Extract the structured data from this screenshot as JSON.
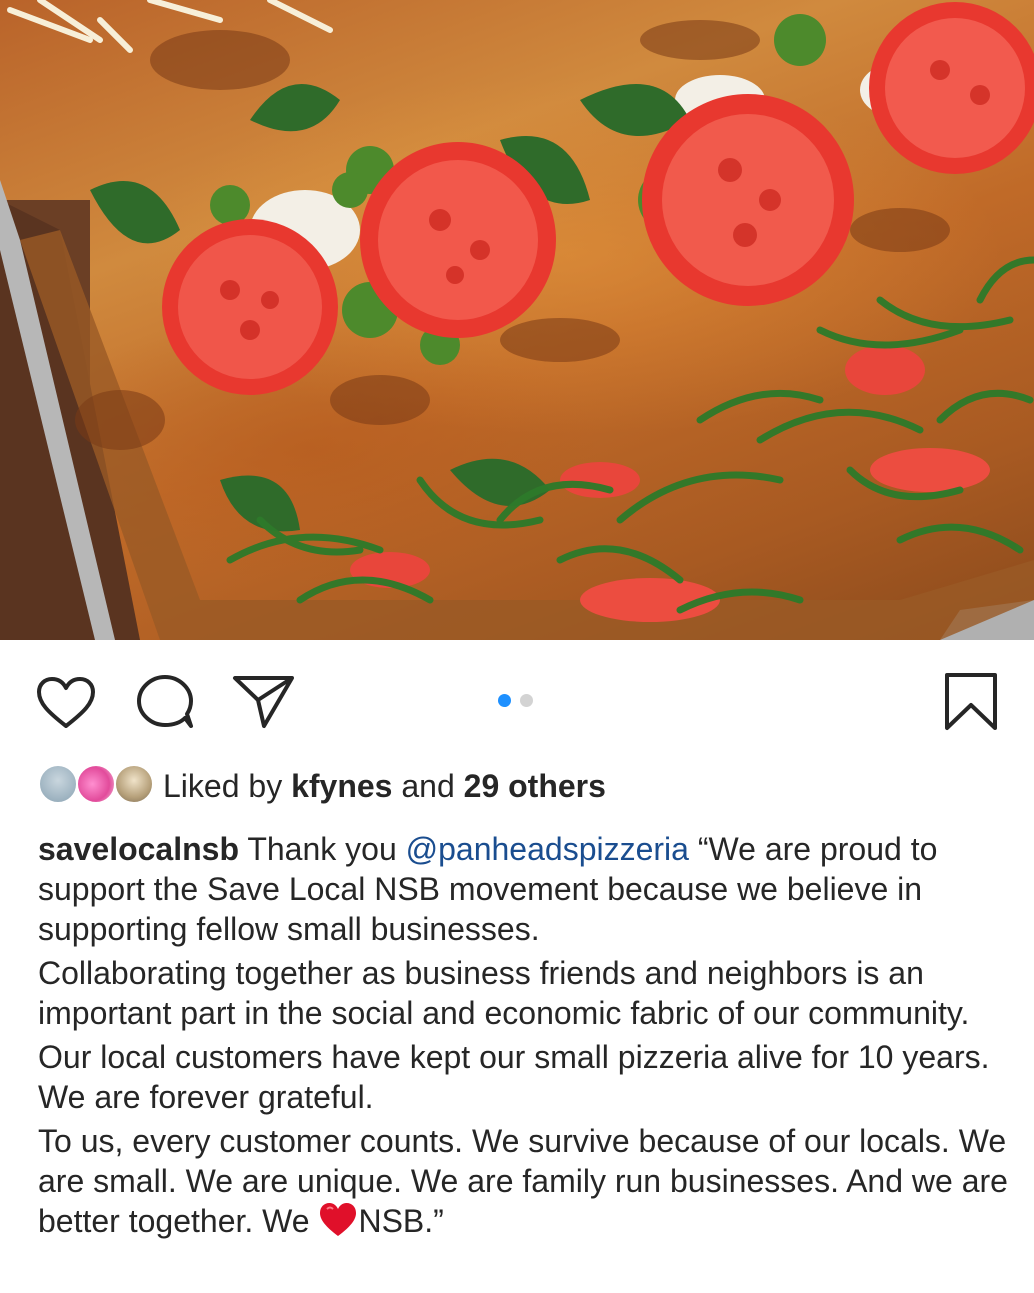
{
  "post": {
    "image_alt_name": "pizza-photo",
    "carousel": {
      "total": 2,
      "active": 1
    },
    "actions": {
      "like_icon": "heart-outline-icon",
      "comment_icon": "comment-bubble-icon",
      "share_icon": "paper-plane-icon",
      "save_icon": "bookmark-outline-icon"
    },
    "likes": {
      "prefix": "Liked by",
      "user": "kfynes",
      "joiner": "and",
      "others": "29 others"
    },
    "caption": {
      "username": "savelocalnsb",
      "lead": " Thank you ",
      "mention": "@panheadspizzeria",
      "para1_rest": " “We are proud to support the Save Local NSB movement because we believe in supporting fellow small businesses.",
      "para2": "Collaborating together as business friends and neighbors is an important part in the social and economic fabric of our community.",
      "para3": "Our local customers have kept our small pizzeria alive for 10 years. We are forever grateful.",
      "para4_start": "To us, every customer counts. We survive because of our locals. We are small. We are unique. We are family run businesses. And we are better together. We ",
      "para4_end": "NSB.”"
    }
  },
  "colors": {
    "accent_dot": "#1e90ff",
    "inactive_dot": "#d3d3d3",
    "text": "#262626",
    "mention": "#1a4d8f",
    "heart_emoji": "#e0102a"
  }
}
